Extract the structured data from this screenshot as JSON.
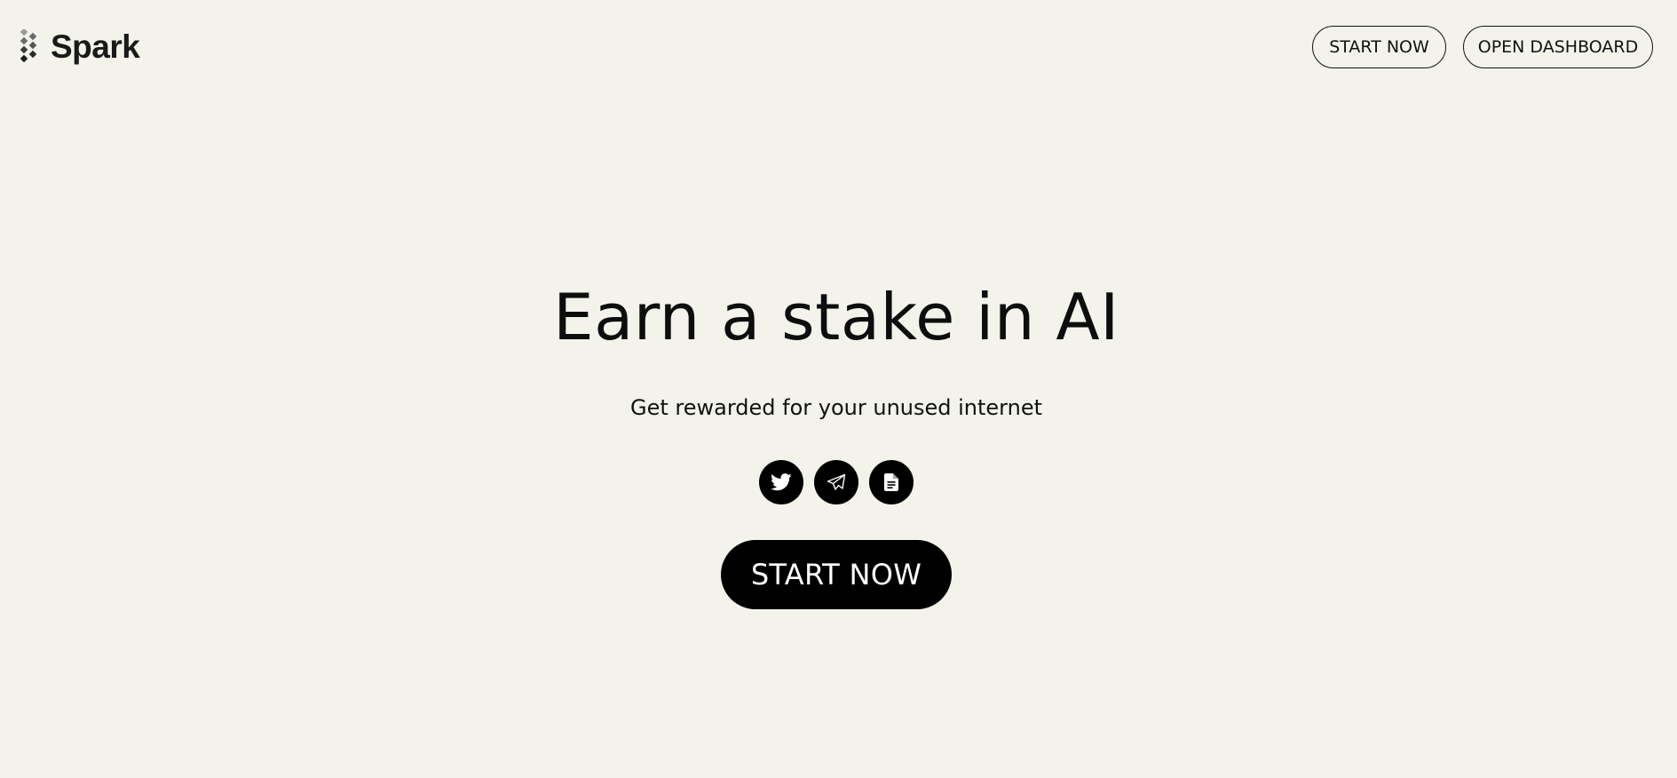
{
  "brand": {
    "name": "Spark",
    "logo_icon": "diamond-grid-logo-icon"
  },
  "header": {
    "start_now_label": "START NOW",
    "open_dashboard_label": "OPEN DASHBOARD"
  },
  "hero": {
    "title": "Earn a stake in AI",
    "subtitle": "Get rewarded for your unused internet",
    "cta_label": "START NOW"
  },
  "socials": [
    {
      "icon": "twitter-icon"
    },
    {
      "icon": "telegram-icon"
    },
    {
      "icon": "document-icon"
    }
  ],
  "colors": {
    "background": "#f3f3ec",
    "primary": "#000000",
    "text": "#111111",
    "on_primary": "#ffffff"
  }
}
